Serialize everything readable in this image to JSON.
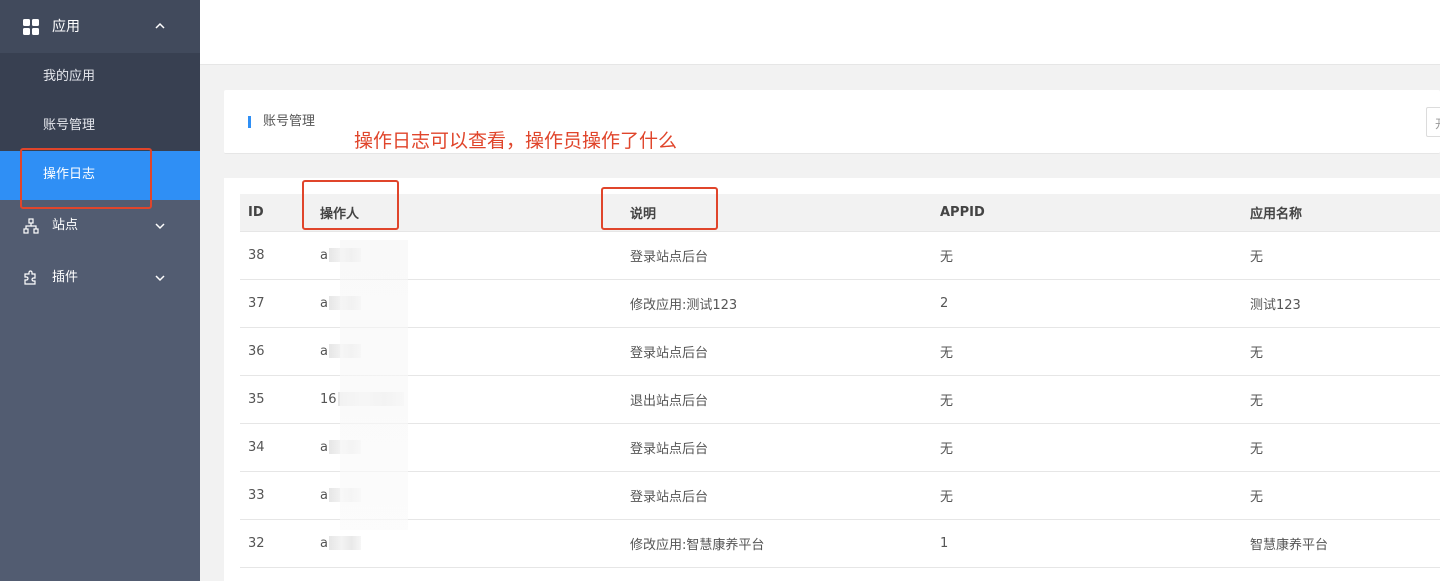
{
  "sidebar": {
    "app_menu": {
      "label": "应用",
      "icon": "apps-grid-icon"
    },
    "sub_items": [
      {
        "label": "我的应用",
        "active": false
      },
      {
        "label": "账号管理",
        "active": false
      },
      {
        "label": "操作日志",
        "active": true
      }
    ],
    "nav_items": [
      {
        "label": "站点",
        "icon": "sitemap-icon"
      },
      {
        "label": "插件",
        "icon": "puzzle-icon"
      }
    ]
  },
  "section": {
    "title": "账号管理",
    "right_control_text": "开"
  },
  "annotation": {
    "text": "操作日志可以查看，操作员操作了什么",
    "color": "#e0452b"
  },
  "table": {
    "headers": [
      "ID",
      "操作人",
      "说明",
      "APPID",
      "应用名称"
    ],
    "rows": [
      {
        "id": "38",
        "operator": "a",
        "desc": "登录站点后台",
        "appid": "无",
        "app_name": "无"
      },
      {
        "id": "37",
        "operator": "a",
        "desc": "修改应用:测试123",
        "appid": "2",
        "app_name": "测试123"
      },
      {
        "id": "36",
        "operator": "a",
        "desc": "登录站点后台",
        "appid": "无",
        "app_name": "无"
      },
      {
        "id": "35",
        "operator": "16",
        "desc": "退出站点后台",
        "appid": "无",
        "app_name": "无"
      },
      {
        "id": "34",
        "operator": "a",
        "desc": "登录站点后台",
        "appid": "无",
        "app_name": "无"
      },
      {
        "id": "33",
        "operator": "a",
        "desc": "登录站点后台",
        "appid": "无",
        "app_name": "无"
      },
      {
        "id": "32",
        "operator": "a",
        "desc": "修改应用:智慧康养平台",
        "appid": "1",
        "app_name": "智慧康养平台"
      }
    ]
  },
  "colors": {
    "sidebar_bg": "#525c71",
    "sidebar_dark": "#384051",
    "accent": "#2f8ff5"
  }
}
